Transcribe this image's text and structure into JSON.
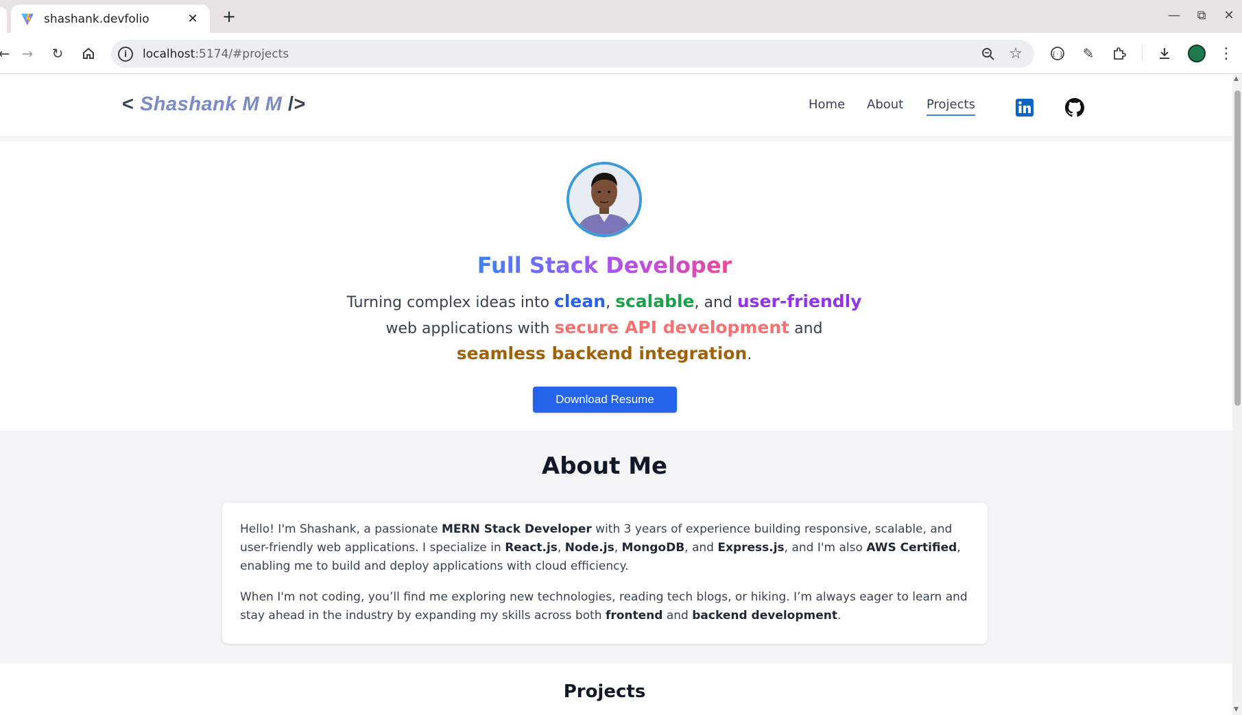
{
  "browser": {
    "tab_title": "shashank.devfolio",
    "tab_close": "✕",
    "new_tab": "+",
    "url_host": "localhost",
    "url_rest": ":5174/#projects"
  },
  "nav": {
    "brand_open": "<",
    "brand_name": "Shashank M M",
    "brand_close": "/>",
    "links": [
      "Home",
      "About",
      "Projects"
    ],
    "active": "Projects",
    "social": [
      "linkedin-icon",
      "github-icon"
    ]
  },
  "hero": {
    "title": "Full Stack Developer",
    "t1": "Turning complex ideas into ",
    "w_clean": "clean",
    "t2": ", ",
    "w_scalable": "scalable",
    "t3": ", and ",
    "w_userfriendly": "user-friendly",
    "t4": " web applications with ",
    "w_secure": "secure API development",
    "t5": " and ",
    "w_seamless": "seamless backend integration",
    "t6": ".",
    "resume_label": "Download Resume",
    "colors": {
      "blue": "#2563eb",
      "green": "#16a34a",
      "purple": "#9333ea",
      "red": "#f87171",
      "brown": "#a16207"
    }
  },
  "about": {
    "title": "About Me",
    "p1": {
      "a": "Hello! I'm Shashank, a passionate ",
      "b1": "MERN Stack Developer",
      "c": " with 3 years of experience building responsive, scalable, and user-friendly web applications. I specialize in ",
      "b2": "React.js",
      "d": ", ",
      "b3": "Node.js",
      "e": ", ",
      "b4": "MongoDB",
      "f": ", and ",
      "b5": "Express.js",
      "g": ", and I'm also ",
      "b6": "AWS Certified",
      "h": ", enabling me to build and deploy applications with cloud efficiency."
    },
    "p2": {
      "a": "When I'm not coding, you’ll find me exploring new technologies, reading tech blogs, or hiking. I’m always eager to learn and stay ahead in the industry by expanding my skills across both ",
      "b1": "frontend",
      "c": " and ",
      "b2": "backend development",
      "d": "."
    }
  },
  "projects": {
    "title": "Projects"
  }
}
